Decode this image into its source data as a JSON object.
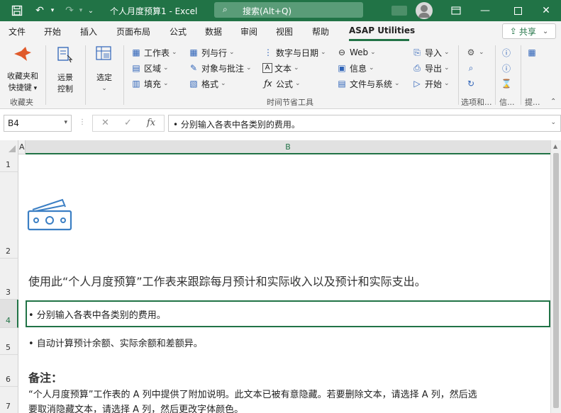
{
  "titlebar": {
    "title": "个人月度预算1  -  Excel",
    "search_placeholder": "搜索(Alt+Q)",
    "save_icon": "save-icon",
    "undo_icon": "undo-icon",
    "redo_icon": "redo-icon",
    "customize_icon": "customize-qat-icon"
  },
  "menu": {
    "tabs": [
      "文件",
      "开始",
      "插入",
      "页面布局",
      "公式",
      "数据",
      "审阅",
      "视图",
      "帮助",
      "ASAP Utilities"
    ],
    "active_tab": "ASAP Utilities",
    "share_label": "共享"
  },
  "ribbon": {
    "favorites": {
      "big_label_1": "收藏夹和",
      "big_label_2": "快捷键",
      "group_label": "收藏夹"
    },
    "remote": {
      "label_1": "远景",
      "label_2": "控制"
    },
    "select": {
      "label": "选定"
    },
    "col1": [
      "工作表",
      "区域",
      "填充"
    ],
    "col2": [
      "列与行",
      "对象与批注",
      "格式"
    ],
    "col3": [
      "数字与日期",
      "文本",
      "公式"
    ],
    "col4": [
      "Web",
      "信息",
      "文件与系统"
    ],
    "col5": [
      "导入",
      "导出",
      "开始"
    ],
    "time_saving_label": "时间节省工具",
    "options_label": "选项和...",
    "info_label": "信...",
    "tips_label": "提..."
  },
  "formula_bar": {
    "name_box": "B4",
    "cancel": "✕",
    "enter": "✓",
    "fx": "fx",
    "content": "• 分别输入各表中各类别的费用。"
  },
  "grid": {
    "col_a": "A",
    "col_b": "B",
    "rows": [
      "1",
      "2",
      "3",
      "4",
      "5",
      "6",
      "7"
    ],
    "intro": "使用此“个人月度预算”工作表来跟踪每月预计和实际收入以及预计和实际支出。",
    "bullet1": "• 分别输入各表中各类别的费用。",
    "bullet2": "• 自动计算预计余额、实际余额和差额异。",
    "note_heading": "备注：",
    "note_line1": "“个人月度预算”工作表的 A 列中提供了附加说明。此文本已被有意隐藏。若要删除文本，请选择 A 列，然后选",
    "note_line2": "要取消隐藏文本，请选择 A 列，然后更改字体颜色。",
    "money_icon": "money-bill-icon"
  },
  "colors": {
    "excel_green": "#217346",
    "ribbon_bg": "#f3f3f3",
    "icon_blue": "#2e63b8",
    "money_icon_blue": "#3b7fc4"
  }
}
